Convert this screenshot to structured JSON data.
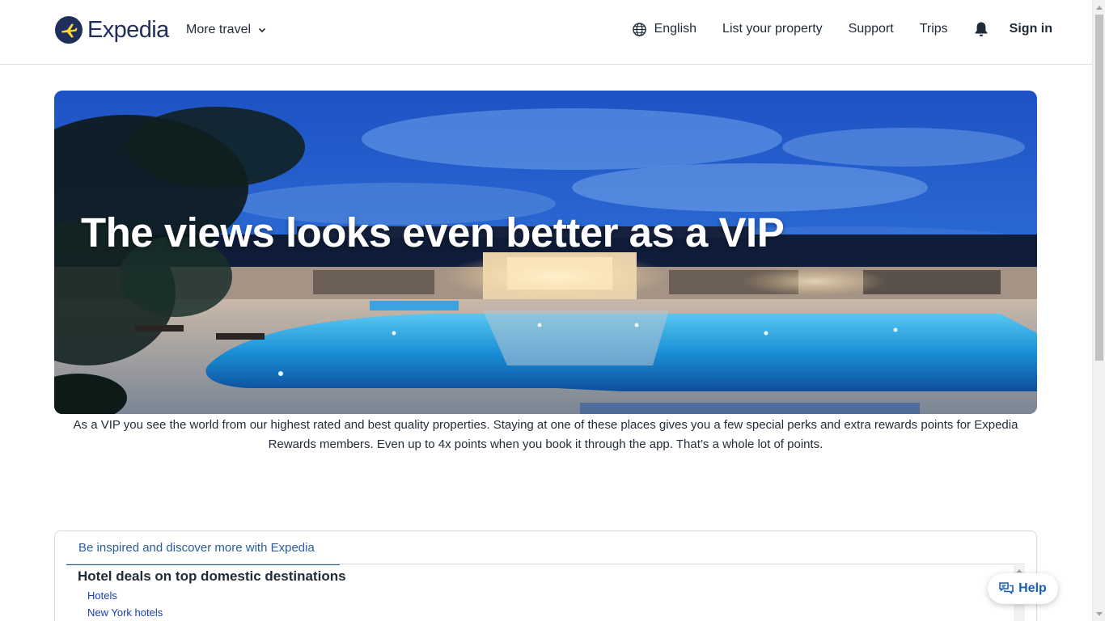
{
  "header": {
    "logo_text": "Expedia",
    "more_travel": "More travel",
    "language": "English",
    "list_property": "List your property",
    "support": "Support",
    "trips": "Trips",
    "sign_in": "Sign in"
  },
  "hero": {
    "title": "The views looks even better as a VIP",
    "description": "As a VIP you see the world from our highest rated and best quality properties. Staying at one of these places gives you a few special perks and extra rewards points for Expedia Rewards members. Even up to 4x points when you book it through the app. That’s a whole lot of points."
  },
  "discover": {
    "tab_label": "Be inspired and discover more with Expedia",
    "section_title": "Hotel deals on top domestic destinations",
    "links": [
      "Hotels",
      "New York hotels"
    ]
  },
  "help": {
    "label": "Help"
  },
  "icons": {
    "logo": "plane-logo-icon",
    "more_travel": "chevron-down-icon",
    "language": "globe-icon",
    "notifications": "bell-icon",
    "help": "chat-icon"
  },
  "colors": {
    "brand_navy": "#1f2f5c",
    "brand_yellow": "#fdd835",
    "link_blue": "#1a3bb5",
    "help_blue": "#1b5fb8"
  }
}
